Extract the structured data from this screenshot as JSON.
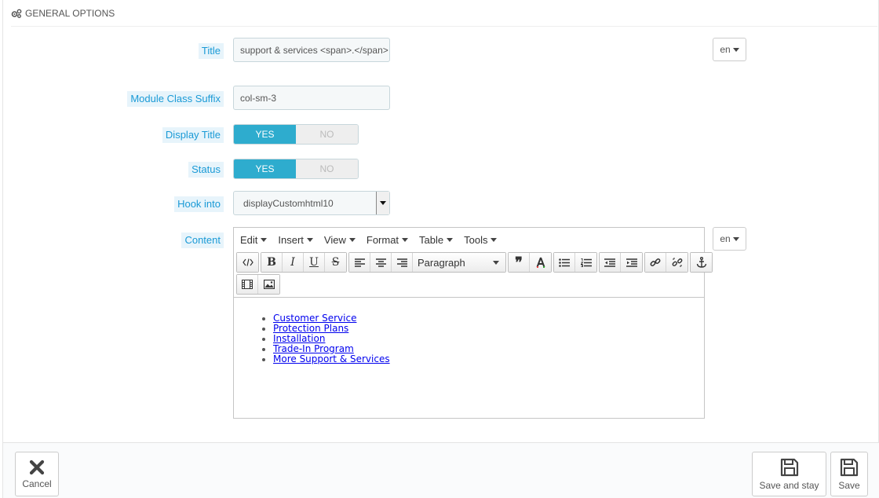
{
  "panel": {
    "heading": "GENERAL OPTIONS"
  },
  "form": {
    "title": {
      "label": "Title",
      "value": "support & services <span>.</span>",
      "lang": "en"
    },
    "module_class_suffix": {
      "label": "Module Class Suffix",
      "value": "col-sm-3"
    },
    "display_title": {
      "label": "Display Title",
      "yes": "YES",
      "no": "NO"
    },
    "status": {
      "label": "Status",
      "yes": "YES",
      "no": "NO"
    },
    "hook_into": {
      "label": "Hook into",
      "value": "displayCustomhtml10"
    },
    "content": {
      "label": "Content",
      "lang": "en"
    }
  },
  "editor": {
    "menus": [
      "Edit",
      "Insert",
      "View",
      "Format",
      "Table",
      "Tools"
    ],
    "format_select": "Paragraph",
    "list_items": [
      "Customer Service",
      "Protection Plans",
      "Installation",
      "Trade-In Program",
      "More Support & Services"
    ]
  },
  "footer": {
    "cancel": "Cancel",
    "save_and_stay": "Save and stay",
    "save": "Save"
  },
  "colors": {
    "accent": "#2eacce",
    "label_bg": "#e7f4fb",
    "label_text": "#1a9ad6",
    "link": "#0000ee"
  }
}
